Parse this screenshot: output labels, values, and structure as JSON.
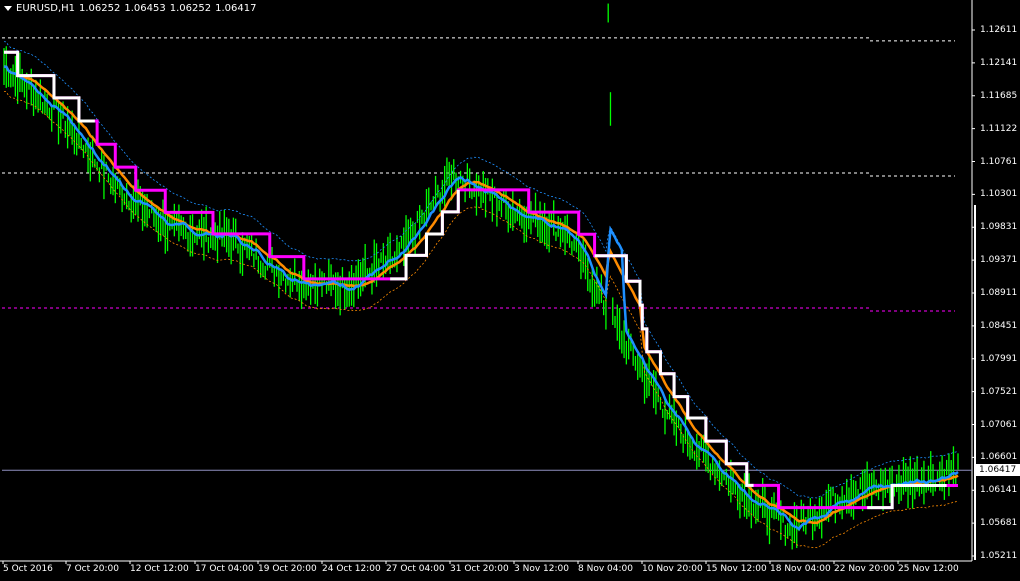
{
  "header": {
    "symbol": "EURUSD,H1",
    "open": "1.06252",
    "high": "1.06453",
    "low": "1.06252",
    "close": "1.06417"
  },
  "price_axis": [
    "1.12611",
    "1.12141",
    "1.11685",
    "1.11122",
    "1.10761",
    "1.10301",
    "1.09831",
    "1.09371",
    "1.08911",
    "1.08451",
    "1.07991",
    "1.07521",
    "1.07061",
    "1.06601",
    "1.06141",
    "1.05681",
    "1.05211"
  ],
  "current_price": "1.06417",
  "time_axis": [
    "5 Oct 2016",
    "7 Oct 20:00",
    "12 Oct 12:00",
    "17 Oct 04:00",
    "19 Oct 20:00",
    "24 Oct 12:00",
    "27 Oct 04:00",
    "31 Oct 20:00",
    "3 Nov 12:00",
    "8 Nov 04:00",
    "10 Nov 20:00",
    "15 Nov 12:00",
    "18 Nov 04:00",
    "22 Nov 20:00",
    "25 Nov 12:00"
  ],
  "colors": {
    "background": "#000000",
    "price": "#00ff00",
    "ma_fast": "#1e90ff",
    "ma_slow": "#ff8c00",
    "step_down": "#ff00ff",
    "step_up": "#ffffff",
    "level_line": "#ffffff",
    "level_magenta": "#ff00ff",
    "current_line": "#9090c0"
  },
  "chart_data": {
    "type": "line",
    "symbol": "EURUSD",
    "timeframe": "H1",
    "ylim": [
      1.0501,
      1.1281
    ],
    "x": [
      "5 Oct 2016",
      "7 Oct 20:00",
      "12 Oct 12:00",
      "17 Oct 04:00",
      "19 Oct 20:00",
      "24 Oct 12:00",
      "27 Oct 04:00",
      "31 Oct 20:00",
      "3 Nov 12:00",
      "8 Nov 04:00",
      "10 Nov 20:00",
      "15 Nov 12:00",
      "18 Nov 04:00",
      "22 Nov 20:00",
      "25 Nov 12:00"
    ],
    "series": [
      {
        "values": [
          1.121,
          1.114,
          1.104,
          1.098,
          1.097,
          1.0915,
          1.09,
          1.094,
          1.106,
          1.101,
          1.098,
          1.083,
          1.07,
          1.062,
          1.056,
          1.061,
          1.0625,
          1.064
        ]
      }
    ],
    "levels": [
      1.125,
      1.106,
      1.087
    ],
    "current_price": 1.06417
  }
}
